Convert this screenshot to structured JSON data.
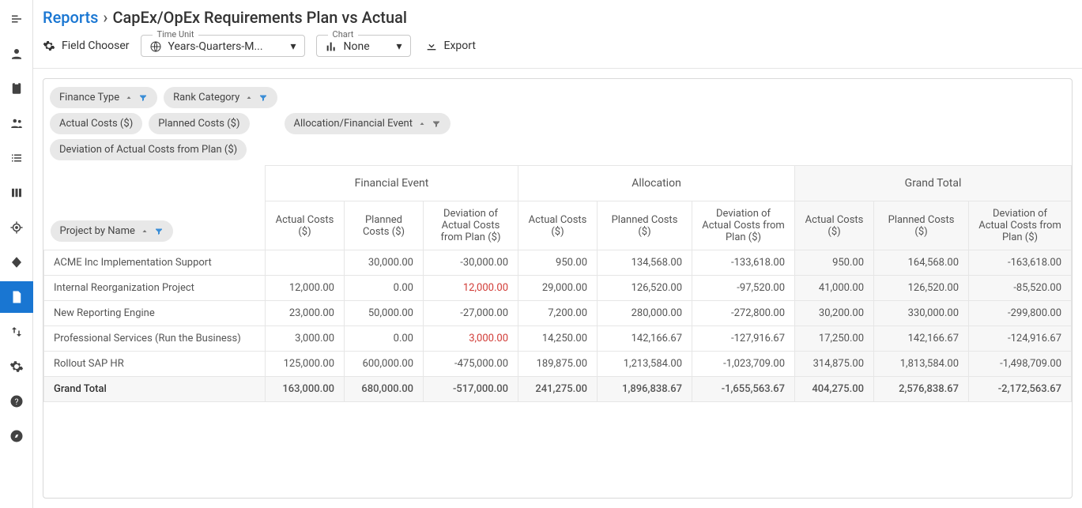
{
  "header": {
    "reports_link": "Reports",
    "title": "CapEx/OpEx Requirements Plan vs Actual"
  },
  "toolbar": {
    "field_chooser": "Field Chooser",
    "time_unit_label": "Time Unit",
    "time_unit_value": "Years-Quarters-M...",
    "chart_label": "Chart",
    "chart_value": "None",
    "export_label": "Export"
  },
  "chips": {
    "row1": [
      "Finance Type",
      "Rank Category"
    ],
    "row2a": [
      "Actual Costs ($)",
      "Planned Costs ($)"
    ],
    "row2b": "Allocation/Financial Event",
    "row3": "Deviation of Actual Costs from Plan ($)",
    "rowHeader": "Project by Name"
  },
  "columns": {
    "groups": [
      "Financial Event",
      "Allocation",
      "Grand Total"
    ],
    "measures": [
      "Actual Costs ($)",
      "Planned Costs ($)",
      "Deviation of Actual Costs from Plan ($)"
    ]
  },
  "rows": [
    {
      "name": "ACME Inc Implementation Support",
      "fe": [
        "",
        "30,000.00",
        "-30,000.00"
      ],
      "al": [
        "950.00",
        "134,568.00",
        "-133,618.00"
      ],
      "gt": [
        "950.00",
        "164,568.00",
        "-163,618.00"
      ],
      "red": []
    },
    {
      "name": "Internal Reorganization Project",
      "fe": [
        "12,000.00",
        "0.00",
        "12,000.00"
      ],
      "al": [
        "29,000.00",
        "126,520.00",
        "-97,520.00"
      ],
      "gt": [
        "41,000.00",
        "126,520.00",
        "-85,520.00"
      ],
      "red": [
        "fe2"
      ]
    },
    {
      "name": "New Reporting Engine",
      "fe": [
        "23,000.00",
        "50,000.00",
        "-27,000.00"
      ],
      "al": [
        "7,200.00",
        "280,000.00",
        "-272,800.00"
      ],
      "gt": [
        "30,200.00",
        "330,000.00",
        "-299,800.00"
      ],
      "red": []
    },
    {
      "name": "Professional Services (Run the Business)",
      "fe": [
        "3,000.00",
        "0.00",
        "3,000.00"
      ],
      "al": [
        "14,250.00",
        "142,166.67",
        "-127,916.67"
      ],
      "gt": [
        "17,250.00",
        "142,166.67",
        "-124,916.67"
      ],
      "red": [
        "fe2"
      ]
    },
    {
      "name": "Rollout SAP HR",
      "fe": [
        "125,000.00",
        "600,000.00",
        "-475,000.00"
      ],
      "al": [
        "189,875.00",
        "1,213,584.00",
        "-1,023,709.00"
      ],
      "gt": [
        "314,875.00",
        "1,813,584.00",
        "-1,498,709.00"
      ],
      "red": []
    }
  ],
  "grandTotal": {
    "name": "Grand Total",
    "fe": [
      "163,000.00",
      "680,000.00",
      "-517,000.00"
    ],
    "al": [
      "241,275.00",
      "1,896,838.67",
      "-1,655,563.67"
    ],
    "gt": [
      "404,275.00",
      "2,576,838.67",
      "-2,172,563.67"
    ]
  }
}
